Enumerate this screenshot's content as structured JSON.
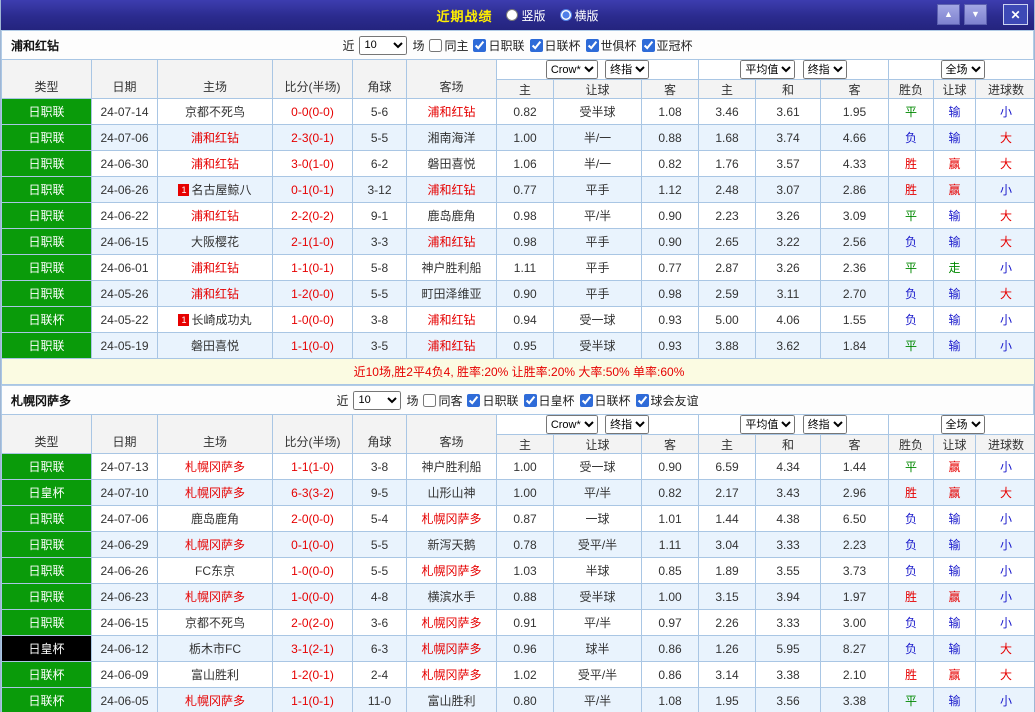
{
  "titlebar": {
    "title": "近期战绩",
    "radio_vertical": "竖版",
    "radio_horizontal": "横版",
    "vertical_selected": false,
    "horizontal_selected": true,
    "icons": {
      "up": "▲",
      "down": "▼",
      "close": "✕"
    }
  },
  "columns": {
    "type": "类型",
    "date": "日期",
    "home": "主场",
    "score": "比分(半场)",
    "corner": "角球",
    "away": "客场",
    "ah_home": "主",
    "ah_line": "让球",
    "ah_away": "客",
    "eu_home": "主",
    "eu_draw": "和",
    "eu_away": "客",
    "result": "胜负",
    "handicap": "让球",
    "goals": "进球数"
  },
  "outcome_colors": {
    "胜": "#e60000",
    "平": "#008800",
    "负": "#1a1acc",
    "赢": "#e60000",
    "走": "#008800",
    "输": "#1a1acc",
    "大": "#e60000",
    "小": "#1a1acc"
  },
  "colors": {
    "focus_team": "#e60000",
    "score": "#e60000",
    "league_green": "#0a9b0a",
    "league_dark": "#000000"
  },
  "sections": [
    {
      "team": "浦和红钻",
      "filter": {
        "near_label": "近",
        "count": "10",
        "games_label": "场",
        "same_label": "同主",
        "same_checked": false,
        "leagues": [
          "日职联",
          "日联杯",
          "世俱杯",
          "亚冠杯"
        ],
        "leagues_checked": [
          true,
          true,
          true,
          true
        ]
      },
      "selectors": {
        "bookmaker": "Crow*",
        "final1": "终指",
        "average": "平均值",
        "final2": "终指",
        "fulltime": "全场"
      },
      "rows": [
        {
          "type": "日职联",
          "type_bg": "#0a9b0a",
          "date": "24-07-14",
          "home": "京都不死鸟",
          "home_focus": false,
          "home_badge": "",
          "score": "0-0(0-0)",
          "corner": "5-6",
          "away": "浦和红钻",
          "away_focus": true,
          "away_badge": "",
          "ah_home": "0.82",
          "ah_line": "受半球",
          "ah_away": "1.08",
          "eu_home": "3.46",
          "eu_draw": "3.61",
          "eu_away": "1.95",
          "result": "平",
          "handicap_result": "输",
          "goals": "小"
        },
        {
          "type": "日职联",
          "type_bg": "#0a9b0a",
          "date": "24-07-06",
          "home": "浦和红钻",
          "home_focus": true,
          "home_badge": "",
          "score": "2-3(0-1)",
          "corner": "5-5",
          "away": "湘南海洋",
          "away_focus": false,
          "away_badge": "",
          "ah_home": "1.00",
          "ah_line": "半/一",
          "ah_away": "0.88",
          "eu_home": "1.68",
          "eu_draw": "3.74",
          "eu_away": "4.66",
          "result": "负",
          "handicap_result": "输",
          "goals": "大"
        },
        {
          "type": "日职联",
          "type_bg": "#0a9b0a",
          "date": "24-06-30",
          "home": "浦和红钻",
          "home_focus": true,
          "home_badge": "",
          "score": "3-0(1-0)",
          "corner": "6-2",
          "away": "磐田喜悦",
          "away_focus": false,
          "away_badge": "",
          "ah_home": "1.06",
          "ah_line": "半/一",
          "ah_away": "0.82",
          "eu_home": "1.76",
          "eu_draw": "3.57",
          "eu_away": "4.33",
          "result": "胜",
          "handicap_result": "赢",
          "goals": "大"
        },
        {
          "type": "日职联",
          "type_bg": "#0a9b0a",
          "date": "24-06-26",
          "home": "名古屋鲸八",
          "home_focus": false,
          "home_badge": "1",
          "score": "0-1(0-1)",
          "corner": "3-12",
          "away": "浦和红钻",
          "away_focus": true,
          "away_badge": "",
          "ah_home": "0.77",
          "ah_line": "平手",
          "ah_away": "1.12",
          "eu_home": "2.48",
          "eu_draw": "3.07",
          "eu_away": "2.86",
          "result": "胜",
          "handicap_result": "赢",
          "goals": "小"
        },
        {
          "type": "日职联",
          "type_bg": "#0a9b0a",
          "date": "24-06-22",
          "home": "浦和红钻",
          "home_focus": true,
          "home_badge": "",
          "score": "2-2(0-2)",
          "corner": "9-1",
          "away": "鹿岛鹿角",
          "away_focus": false,
          "away_badge": "",
          "ah_home": "0.98",
          "ah_line": "平/半",
          "ah_away": "0.90",
          "eu_home": "2.23",
          "eu_draw": "3.26",
          "eu_away": "3.09",
          "result": "平",
          "handicap_result": "输",
          "goals": "大"
        },
        {
          "type": "日职联",
          "type_bg": "#0a9b0a",
          "date": "24-06-15",
          "home": "大阪樱花",
          "home_focus": false,
          "home_badge": "",
          "score": "2-1(1-0)",
          "corner": "3-3",
          "away": "浦和红钻",
          "away_focus": true,
          "away_badge": "",
          "ah_home": "0.98",
          "ah_line": "平手",
          "ah_away": "0.90",
          "eu_home": "2.65",
          "eu_draw": "3.22",
          "eu_away": "2.56",
          "result": "负",
          "handicap_result": "输",
          "goals": "大"
        },
        {
          "type": "日职联",
          "type_bg": "#0a9b0a",
          "date": "24-06-01",
          "home": "浦和红钻",
          "home_focus": true,
          "home_badge": "",
          "score": "1-1(0-1)",
          "corner": "5-8",
          "away": "神户胜利船",
          "away_focus": false,
          "away_badge": "",
          "ah_home": "1.11",
          "ah_line": "平手",
          "ah_away": "0.77",
          "eu_home": "2.87",
          "eu_draw": "3.26",
          "eu_away": "2.36",
          "result": "平",
          "handicap_result": "走",
          "goals": "小"
        },
        {
          "type": "日职联",
          "type_bg": "#0a9b0a",
          "date": "24-05-26",
          "home": "浦和红钻",
          "home_focus": true,
          "home_badge": "",
          "score": "1-2(0-0)",
          "corner": "5-5",
          "away": "町田泽维亚",
          "away_focus": false,
          "away_badge": "",
          "ah_home": "0.90",
          "ah_line": "平手",
          "ah_away": "0.98",
          "eu_home": "2.59",
          "eu_draw": "3.11",
          "eu_away": "2.70",
          "result": "负",
          "handicap_result": "输",
          "goals": "大"
        },
        {
          "type": "日联杯",
          "type_bg": "#0a9b0a",
          "date": "24-05-22",
          "home": "长崎成功丸",
          "home_focus": false,
          "home_badge": "1",
          "score": "1-0(0-0)",
          "corner": "3-8",
          "away": "浦和红钻",
          "away_focus": true,
          "away_badge": "",
          "ah_home": "0.94",
          "ah_line": "受一球",
          "ah_away": "0.93",
          "eu_home": "5.00",
          "eu_draw": "4.06",
          "eu_away": "1.55",
          "result": "负",
          "handicap_result": "输",
          "goals": "小"
        },
        {
          "type": "日职联",
          "type_bg": "#0a9b0a",
          "date": "24-05-19",
          "home": "磐田喜悦",
          "home_focus": false,
          "home_badge": "",
          "score": "1-1(0-0)",
          "corner": "3-5",
          "away": "浦和红钻",
          "away_focus": true,
          "away_badge": "",
          "ah_home": "0.95",
          "ah_line": "受半球",
          "ah_away": "0.93",
          "eu_home": "3.88",
          "eu_draw": "3.62",
          "eu_away": "1.84",
          "result": "平",
          "handicap_result": "输",
          "goals": "小"
        }
      ],
      "summary": "近10场,胜2平4负4, 胜率:20% 让胜率:20% 大率:50% 单率:60%"
    },
    {
      "team": "札幌冈萨多",
      "filter": {
        "near_label": "近",
        "count": "10",
        "games_label": "场",
        "same_label": "同客",
        "same_checked": false,
        "leagues": [
          "日职联",
          "日皇杯",
          "日联杯",
          "球会友谊"
        ],
        "leagues_checked": [
          true,
          true,
          true,
          true
        ]
      },
      "selectors": {
        "bookmaker": "Crow*",
        "final1": "终指",
        "average": "平均值",
        "final2": "终指",
        "fulltime": "全场"
      },
      "rows": [
        {
          "type": "日职联",
          "type_bg": "#0a9b0a",
          "date": "24-07-13",
          "home": "札幌冈萨多",
          "home_focus": true,
          "home_badge": "",
          "score": "1-1(1-0)",
          "corner": "3-8",
          "away": "神户胜利船",
          "away_focus": false,
          "away_badge": "",
          "ah_home": "1.00",
          "ah_line": "受一球",
          "ah_away": "0.90",
          "eu_home": "6.59",
          "eu_draw": "4.34",
          "eu_away": "1.44",
          "result": "平",
          "handicap_result": "赢",
          "goals": "小"
        },
        {
          "type": "日皇杯",
          "type_bg": "#0a9b0a",
          "date": "24-07-10",
          "home": "札幌冈萨多",
          "home_focus": true,
          "home_badge": "",
          "score": "6-3(3-2)",
          "corner": "9-5",
          "away": "山形山神",
          "away_focus": false,
          "away_badge": "",
          "ah_home": "1.00",
          "ah_line": "平/半",
          "ah_away": "0.82",
          "eu_home": "2.17",
          "eu_draw": "3.43",
          "eu_away": "2.96",
          "result": "胜",
          "handicap_result": "赢",
          "goals": "大"
        },
        {
          "type": "日职联",
          "type_bg": "#0a9b0a",
          "date": "24-07-06",
          "home": "鹿岛鹿角",
          "home_focus": false,
          "home_badge": "",
          "score": "2-0(0-0)",
          "corner": "5-4",
          "away": "札幌冈萨多",
          "away_focus": true,
          "away_badge": "",
          "ah_home": "0.87",
          "ah_line": "一球",
          "ah_away": "1.01",
          "eu_home": "1.44",
          "eu_draw": "4.38",
          "eu_away": "6.50",
          "result": "负",
          "handicap_result": "输",
          "goals": "小"
        },
        {
          "type": "日职联",
          "type_bg": "#0a9b0a",
          "date": "24-06-29",
          "home": "札幌冈萨多",
          "home_focus": true,
          "home_badge": "",
          "score": "0-1(0-0)",
          "corner": "5-5",
          "away": "新泻天鹅",
          "away_focus": false,
          "away_badge": "",
          "ah_home": "0.78",
          "ah_line": "受平/半",
          "ah_away": "1.11",
          "eu_home": "3.04",
          "eu_draw": "3.33",
          "eu_away": "2.23",
          "result": "负",
          "handicap_result": "输",
          "goals": "小"
        },
        {
          "type": "日职联",
          "type_bg": "#0a9b0a",
          "date": "24-06-26",
          "home": "FC东京",
          "home_focus": false,
          "home_badge": "",
          "score": "1-0(0-0)",
          "corner": "5-5",
          "away": "札幌冈萨多",
          "away_focus": true,
          "away_badge": "",
          "ah_home": "1.03",
          "ah_line": "半球",
          "ah_away": "0.85",
          "eu_home": "1.89",
          "eu_draw": "3.55",
          "eu_away": "3.73",
          "result": "负",
          "handicap_result": "输",
          "goals": "小"
        },
        {
          "type": "日职联",
          "type_bg": "#0a9b0a",
          "date": "24-06-23",
          "home": "札幌冈萨多",
          "home_focus": true,
          "home_badge": "",
          "score": "1-0(0-0)",
          "corner": "4-8",
          "away": "横滨水手",
          "away_focus": false,
          "away_badge": "",
          "ah_home": "0.88",
          "ah_line": "受半球",
          "ah_away": "1.00",
          "eu_home": "3.15",
          "eu_draw": "3.94",
          "eu_away": "1.97",
          "result": "胜",
          "handicap_result": "赢",
          "goals": "小"
        },
        {
          "type": "日职联",
          "type_bg": "#0a9b0a",
          "date": "24-06-15",
          "home": "京都不死鸟",
          "home_focus": false,
          "home_badge": "",
          "score": "2-0(2-0)",
          "corner": "3-6",
          "away": "札幌冈萨多",
          "away_focus": true,
          "away_badge": "",
          "ah_home": "0.91",
          "ah_line": "平/半",
          "ah_away": "0.97",
          "eu_home": "2.26",
          "eu_draw": "3.33",
          "eu_away": "3.00",
          "result": "负",
          "handicap_result": "输",
          "goals": "小"
        },
        {
          "type": "日皇杯",
          "type_bg": "#000000",
          "date": "24-06-12",
          "home": "栃木市FC",
          "home_focus": false,
          "home_badge": "",
          "score": "3-1(2-1)",
          "corner": "6-3",
          "away": "札幌冈萨多",
          "away_focus": true,
          "away_badge": "",
          "ah_home": "0.96",
          "ah_line": "球半",
          "ah_away": "0.86",
          "eu_home": "1.26",
          "eu_draw": "5.95",
          "eu_away": "8.27",
          "result": "负",
          "handicap_result": "输",
          "goals": "大"
        },
        {
          "type": "日联杯",
          "type_bg": "#0a9b0a",
          "date": "24-06-09",
          "home": "富山胜利",
          "home_focus": false,
          "home_badge": "",
          "score": "1-2(0-1)",
          "corner": "2-4",
          "away": "札幌冈萨多",
          "away_focus": true,
          "away_badge": "",
          "ah_home": "1.02",
          "ah_line": "受平/半",
          "ah_away": "0.86",
          "eu_home": "3.14",
          "eu_draw": "3.38",
          "eu_away": "2.10",
          "result": "胜",
          "handicap_result": "赢",
          "goals": "大"
        },
        {
          "type": "日联杯",
          "type_bg": "#0a9b0a",
          "date": "24-06-05",
          "home": "札幌冈萨多",
          "home_focus": true,
          "home_badge": "",
          "score": "1-1(0-1)",
          "corner": "11-0",
          "away": "富山胜利",
          "away_focus": false,
          "away_badge": "",
          "ah_home": "0.80",
          "ah_line": "平/半",
          "ah_away": "1.08",
          "eu_home": "1.95",
          "eu_draw": "3.56",
          "eu_away": "3.38",
          "result": "平",
          "handicap_result": "输",
          "goals": "小"
        }
      ]
    }
  ]
}
